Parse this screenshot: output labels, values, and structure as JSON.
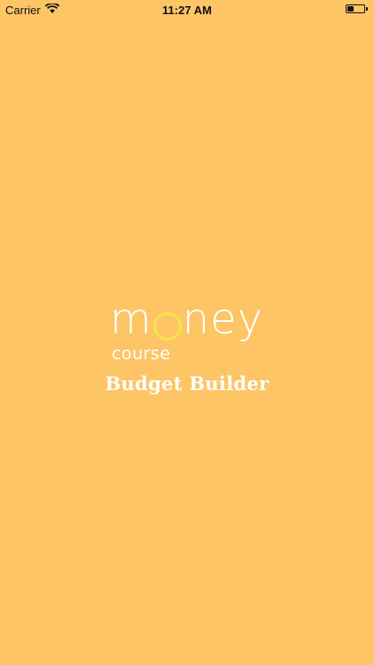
{
  "status_bar": {
    "carrier": "Carrier",
    "time": "11:27 AM",
    "wifi_icon": "wifi-icon",
    "battery_icon": "battery-icon",
    "battery_level": 0.4
  },
  "splash": {
    "logo_part1": "m",
    "logo_part2": "ney",
    "logo_sub": "course",
    "app_title": "Budget Builder"
  },
  "colors": {
    "background": "#FDC566",
    "logo_text": "#FFFFFF",
    "logo_ring": "#F6E34A"
  }
}
